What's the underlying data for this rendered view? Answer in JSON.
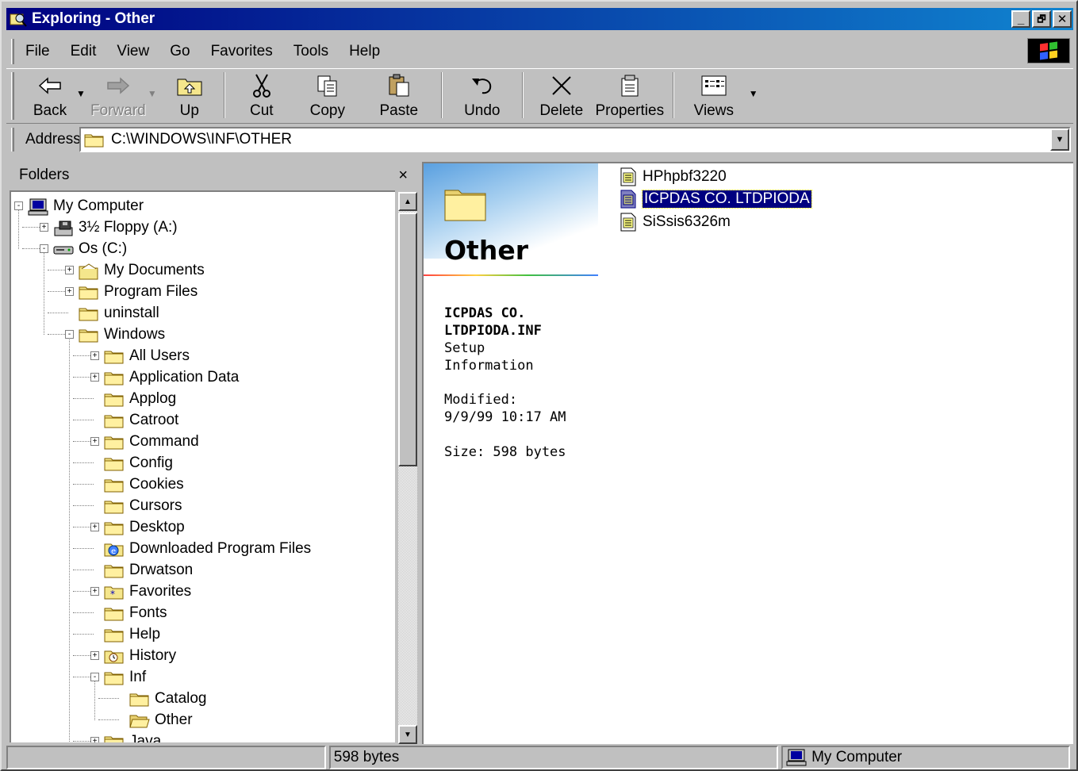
{
  "window": {
    "title": "Exploring - Other",
    "minimize": "_",
    "maximize": "🗗",
    "close": "✕"
  },
  "menu": [
    "File",
    "Edit",
    "View",
    "Go",
    "Favorites",
    "Tools",
    "Help"
  ],
  "toolbar": {
    "back": "Back",
    "forward": "Forward",
    "up": "Up",
    "cut": "Cut",
    "copy": "Copy",
    "paste": "Paste",
    "undo": "Undo",
    "delete": "Delete",
    "properties": "Properties",
    "views": "Views"
  },
  "address": {
    "label": "Address",
    "value": "C:\\WINDOWS\\INF\\OTHER"
  },
  "folders": {
    "header": "Folders",
    "close": "×",
    "items": [
      {
        "label": "My Computer",
        "expander": "-",
        "icon": "computer-icon"
      },
      {
        "label": "3½ Floppy (A:)",
        "expander": "+",
        "icon": "floppy-icon"
      },
      {
        "label": "Os (C:)",
        "expander": "-",
        "icon": "drive-icon"
      },
      {
        "label": "My Documents",
        "expander": "+",
        "icon": "mydocs-icon"
      },
      {
        "label": "Program Files",
        "expander": "+",
        "icon": "folder-icon"
      },
      {
        "label": "uninstall",
        "expander": "",
        "icon": "folder-icon"
      },
      {
        "label": "Windows",
        "expander": "-",
        "icon": "folder-icon"
      },
      {
        "label": "All Users",
        "expander": "+",
        "icon": "folder-icon"
      },
      {
        "label": "Application Data",
        "expander": "+",
        "icon": "folder-icon"
      },
      {
        "label": "Applog",
        "expander": "",
        "icon": "folder-icon"
      },
      {
        "label": "Catroot",
        "expander": "",
        "icon": "folder-icon"
      },
      {
        "label": "Command",
        "expander": "+",
        "icon": "folder-icon"
      },
      {
        "label": "Config",
        "expander": "",
        "icon": "folder-icon"
      },
      {
        "label": "Cookies",
        "expander": "",
        "icon": "folder-icon"
      },
      {
        "label": "Cursors",
        "expander": "",
        "icon": "folder-icon"
      },
      {
        "label": "Desktop",
        "expander": "+",
        "icon": "folder-icon"
      },
      {
        "label": "Downloaded Program Files",
        "expander": "",
        "icon": "ie-folder-icon"
      },
      {
        "label": "Drwatson",
        "expander": "",
        "icon": "folder-icon"
      },
      {
        "label": "Favorites",
        "expander": "+",
        "icon": "favorites-icon"
      },
      {
        "label": "Fonts",
        "expander": "",
        "icon": "folder-icon"
      },
      {
        "label": "Help",
        "expander": "",
        "icon": "folder-icon"
      },
      {
        "label": "History",
        "expander": "+",
        "icon": "history-icon"
      },
      {
        "label": "Inf",
        "expander": "-",
        "icon": "folder-icon"
      },
      {
        "label": "Catalog",
        "expander": "",
        "icon": "folder-icon"
      },
      {
        "label": "Other",
        "expander": "",
        "icon": "open-folder-icon"
      },
      {
        "label": "Java",
        "expander": "+",
        "icon": "folder-icon"
      }
    ]
  },
  "content": {
    "folder_title": "Other",
    "selected_name": "ICPDAS CO. LTDPIODA.INF",
    "type": "Setup Information",
    "modified_label": "Modified:",
    "modified_value": "9/9/99 10:17 AM",
    "size": "Size: 598 bytes",
    "files": [
      {
        "name": "HPhpbf3220",
        "selected": false
      },
      {
        "name": "ICPDAS CO. LTDPIODA",
        "selected": true
      },
      {
        "name": "SiSsis6326m",
        "selected": false
      }
    ]
  },
  "status": {
    "size": "598 bytes",
    "zone": "My Computer"
  },
  "colors": {
    "titlebar_start": "#000080",
    "titlebar_end": "#1084d0",
    "face": "#c0c0c0",
    "selection": "#000080",
    "folder": "#f5e68c"
  }
}
